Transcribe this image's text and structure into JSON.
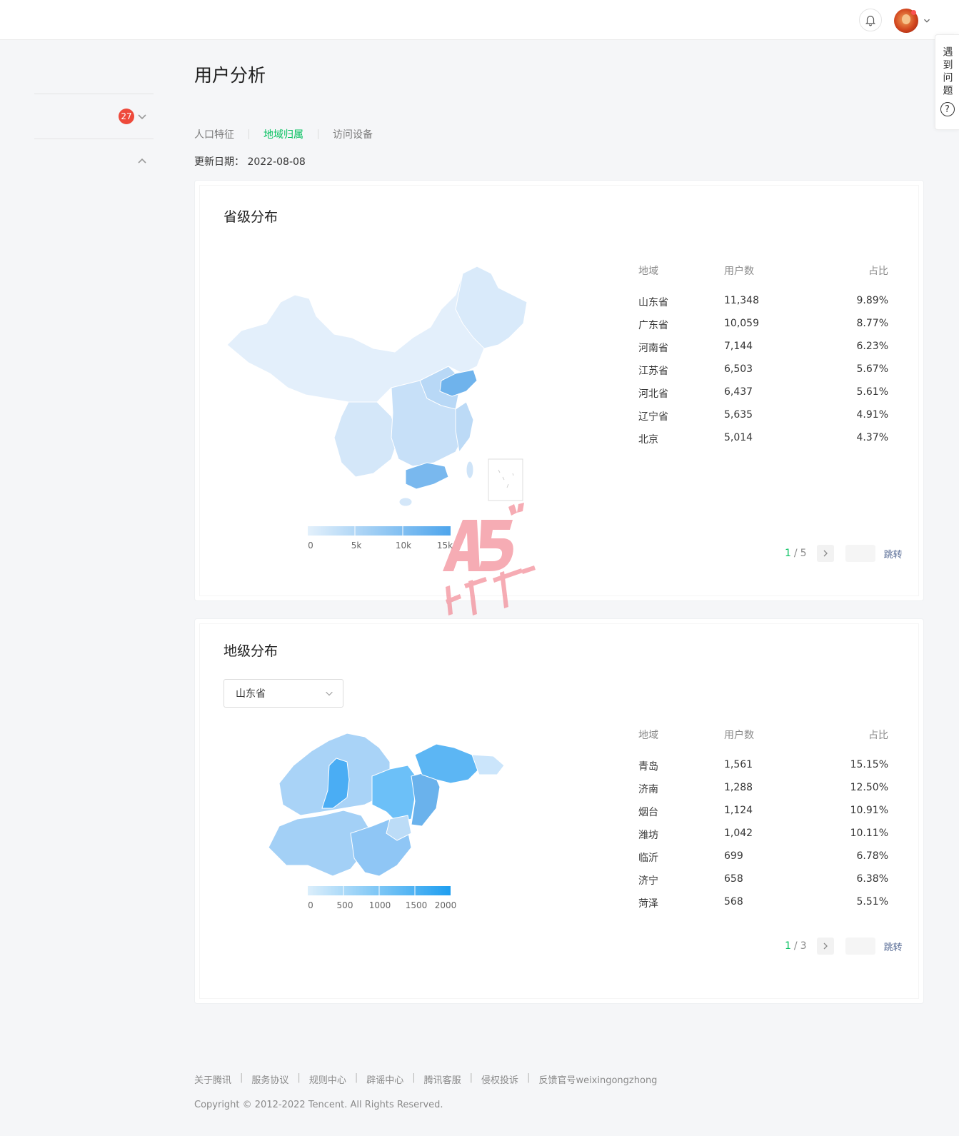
{
  "page_title": "用户分析",
  "header": {
    "bell_icon": "bell-icon",
    "avatar_icon": "user-avatar"
  },
  "help": {
    "label": "遇到问题",
    "icon": "?"
  },
  "sidebar": {
    "badge_count": "27"
  },
  "tabs": [
    {
      "label": "人口特征",
      "active": false
    },
    {
      "label": "地域归属",
      "active": true
    },
    {
      "label": "访问设备",
      "active": false
    }
  ],
  "update": {
    "label": "更新日期：",
    "value": "2022-08-08"
  },
  "province": {
    "title": "省级分布",
    "legend_ticks": [
      "0",
      "5k",
      "10k",
      "15k"
    ],
    "table_head": {
      "region": "地域",
      "users": "用户数",
      "ratio": "占比"
    },
    "rows": [
      {
        "region": "山东省",
        "users": "11,348",
        "ratio": "9.89%"
      },
      {
        "region": "广东省",
        "users": "10,059",
        "ratio": "8.77%"
      },
      {
        "region": "河南省",
        "users": "7,144",
        "ratio": "6.23%"
      },
      {
        "region": "江苏省",
        "users": "6,503",
        "ratio": "5.67%"
      },
      {
        "region": "河北省",
        "users": "6,437",
        "ratio": "5.61%"
      },
      {
        "region": "辽宁省",
        "users": "5,635",
        "ratio": "4.91%"
      },
      {
        "region": "北京",
        "users": "5,014",
        "ratio": "4.37%"
      }
    ],
    "pager": {
      "current": "1",
      "total": "5",
      "jump": "跳转"
    }
  },
  "city": {
    "title": "地级分布",
    "select_value": "山东省",
    "legend_ticks": [
      "0",
      "500",
      "1000",
      "1500",
      "2000"
    ],
    "table_head": {
      "region": "地域",
      "users": "用户数",
      "ratio": "占比"
    },
    "rows": [
      {
        "region": "青岛",
        "users": "1,561",
        "ratio": "15.15%"
      },
      {
        "region": "济南",
        "users": "1,288",
        "ratio": "12.50%"
      },
      {
        "region": "烟台",
        "users": "1,124",
        "ratio": "10.91%"
      },
      {
        "region": "潍坊",
        "users": "1,042",
        "ratio": "10.11%"
      },
      {
        "region": "临沂",
        "users": "699",
        "ratio": "6.78%"
      },
      {
        "region": "济宁",
        "users": "658",
        "ratio": "6.38%"
      },
      {
        "region": "菏泽",
        "users": "568",
        "ratio": "5.51%"
      }
    ],
    "pager": {
      "current": "1",
      "total": "3",
      "jump": "跳转"
    }
  },
  "footer": {
    "links": [
      "关于腾讯",
      "服务协议",
      "规则中心",
      "辟谣中心",
      "腾讯客服",
      "侵权投诉",
      "反馈官号weixingongzhong"
    ],
    "copyright": "Copyright © 2012-2022 Tencent. All Rights Reserved."
  },
  "colors": {
    "accent": "#07c160",
    "map_low": "#e3f0fb",
    "map_high": "#1e9ef0",
    "link": "#576b95"
  }
}
